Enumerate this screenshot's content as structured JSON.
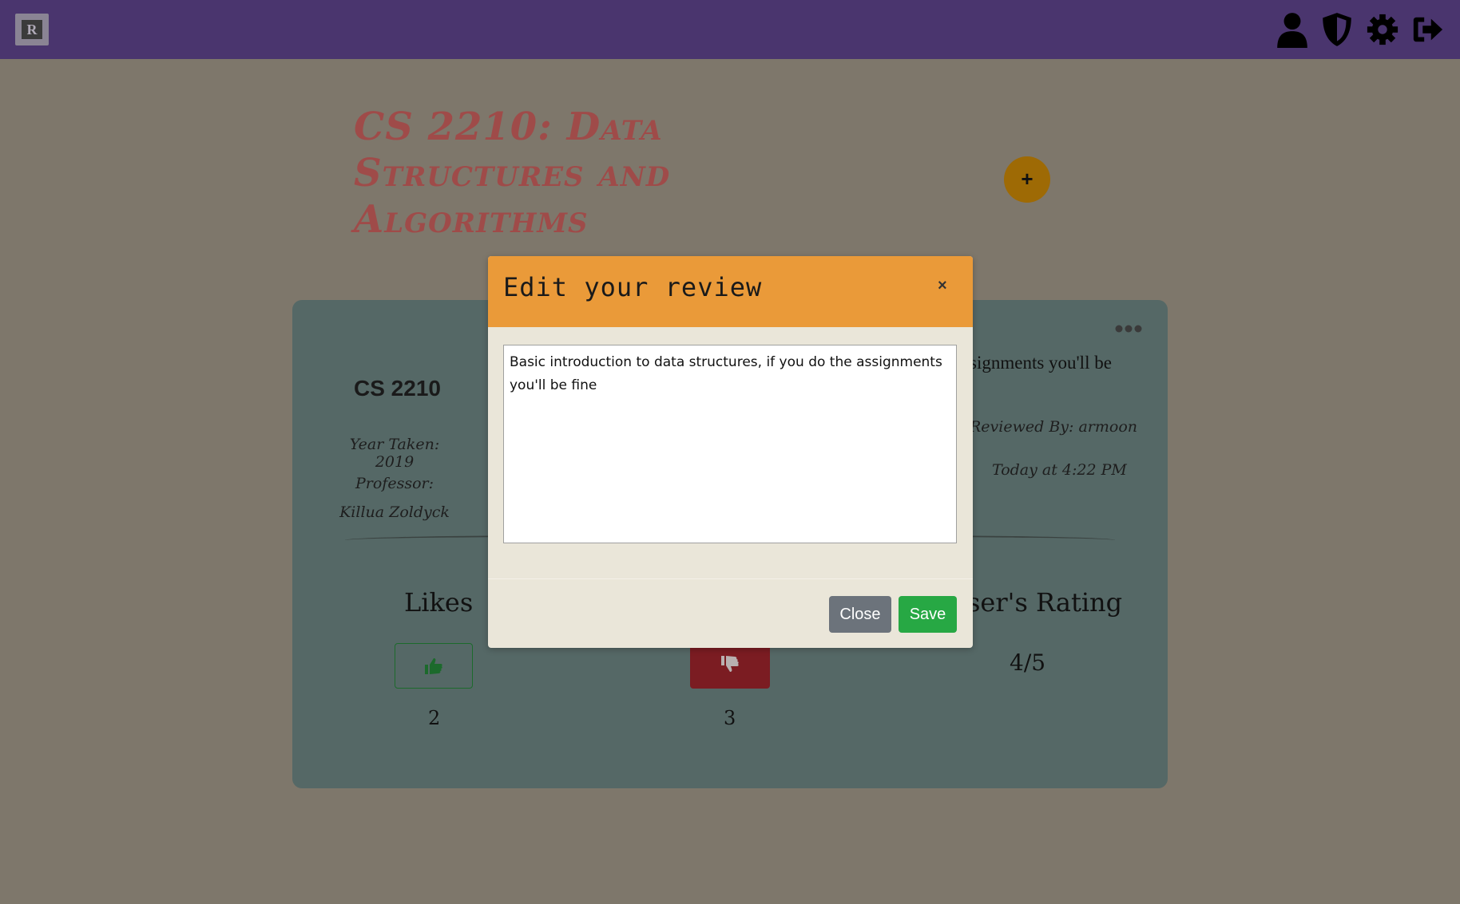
{
  "navbar": {
    "logo_letter": "R",
    "icons": [
      "user-icon",
      "shield-icon",
      "gear-icon",
      "sign-out-icon"
    ]
  },
  "course": {
    "title": "CS 2210: Data Structures and Algorithms",
    "add_label": "+"
  },
  "review_card": {
    "course_code": "CS 2210",
    "year_taken": "Year Taken: 2019",
    "professor": "Professor: Killua Zoldyck",
    "review_excerpt": "signments you'll be",
    "reviewed_by": "Reviewed By: armoon",
    "timestamp": "Today at 4:22 PM",
    "likes_label": "Likes",
    "likes_count": "2",
    "dislikes_count": "3",
    "rating_label": "ser's Rating",
    "rating_value": "4/5"
  },
  "modal": {
    "title": "Edit your review",
    "close_x": "×",
    "review_text": "Basic introduction to data structures, if you do the assignments you'll be fine",
    "close_label": "Close",
    "save_label": "Save"
  },
  "colors": {
    "navbar": "#4a356e",
    "background": "#7e776b",
    "card": "#556866",
    "modal_header": "#ea9a39",
    "save": "#27a844",
    "close": "#6c737b",
    "title": "#9f4b49"
  }
}
